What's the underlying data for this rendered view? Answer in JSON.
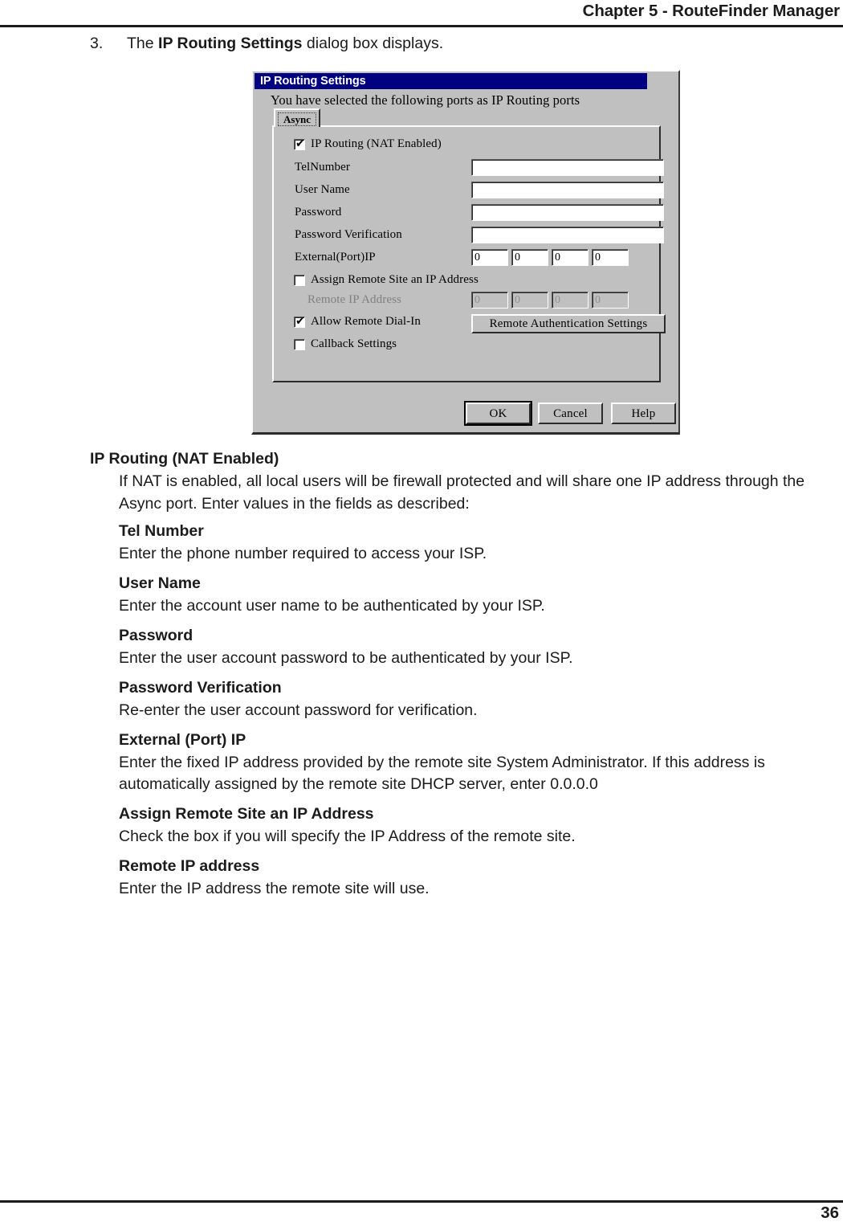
{
  "page": {
    "header_title": "Chapter 5 - RouteFinder Manager",
    "page_number": "36",
    "step_number": "3.",
    "step_text_before": "The ",
    "step_text_bold": "IP Routing Settings",
    "step_text_after": " dialog box displays."
  },
  "dialog": {
    "title": "IP Routing Settings",
    "subtitle": "You have selected the following ports as IP Routing ports",
    "tab_label": "Async",
    "nat_checkbox_label": "IP Routing (NAT Enabled)",
    "nat_checkbox_checked": true,
    "nat_checkbox_mark": "✔",
    "fields": [
      {
        "label": "TelNumber",
        "value": ""
      },
      {
        "label": "User Name",
        "value": ""
      },
      {
        "label": "Password",
        "value": ""
      },
      {
        "label": "Password Verification",
        "value": ""
      }
    ],
    "external_ip": {
      "label": "External(Port)IP",
      "octets": [
        "0",
        "0",
        "0",
        "0"
      ]
    },
    "assign_remote": {
      "label": "Assign Remote Site an IP Address",
      "checked": false
    },
    "remote_ip": {
      "label": "Remote IP Address",
      "octets": [
        "0",
        "0",
        "0",
        "0"
      ],
      "disabled": true
    },
    "allow_remote_dialin": {
      "label": "Allow Remote Dial-In",
      "checked": true,
      "mark": "✔"
    },
    "callback_settings": {
      "label": "Callback Settings",
      "checked": false
    },
    "remote_auth_button": "Remote Authentication Settings",
    "buttons": {
      "ok": "OK",
      "cancel": "Cancel",
      "help": "Help"
    },
    "colors": {
      "titlebar": "#000080",
      "face": "#c0c0c0",
      "field": "#ffffff",
      "disabled_text": "#808080"
    }
  },
  "sections": [
    {
      "heading": "IP Routing (NAT Enabled)",
      "body": "If NAT is enabled, all local users will be firewall protected and will share one IP address through the Async port.  Enter values in the fields as described:"
    },
    {
      "heading": "Tel Number",
      "body": "Enter the phone number required to access your ISP."
    },
    {
      "heading": "User Name",
      "body": "Enter the account user name to be authenticated by your ISP."
    },
    {
      "heading": "Password",
      "body": "Enter the user account password to be authenticated by your ISP."
    },
    {
      "heading": "Password Verification",
      "body": "Re-enter the user account password for verification."
    },
    {
      "heading": "External (Port) IP",
      "body": "Enter the fixed IP address provided by the remote site System Administrator.  If this address is automatically assigned by the remote site DHCP server, enter 0.0.0.0"
    },
    {
      "heading": "Assign Remote Site an IP Address",
      "body": "Check the box if you will specify the IP Address of the remote site."
    },
    {
      "heading": "Remote IP address",
      "body": "Enter the IP address the remote site will use."
    }
  ]
}
